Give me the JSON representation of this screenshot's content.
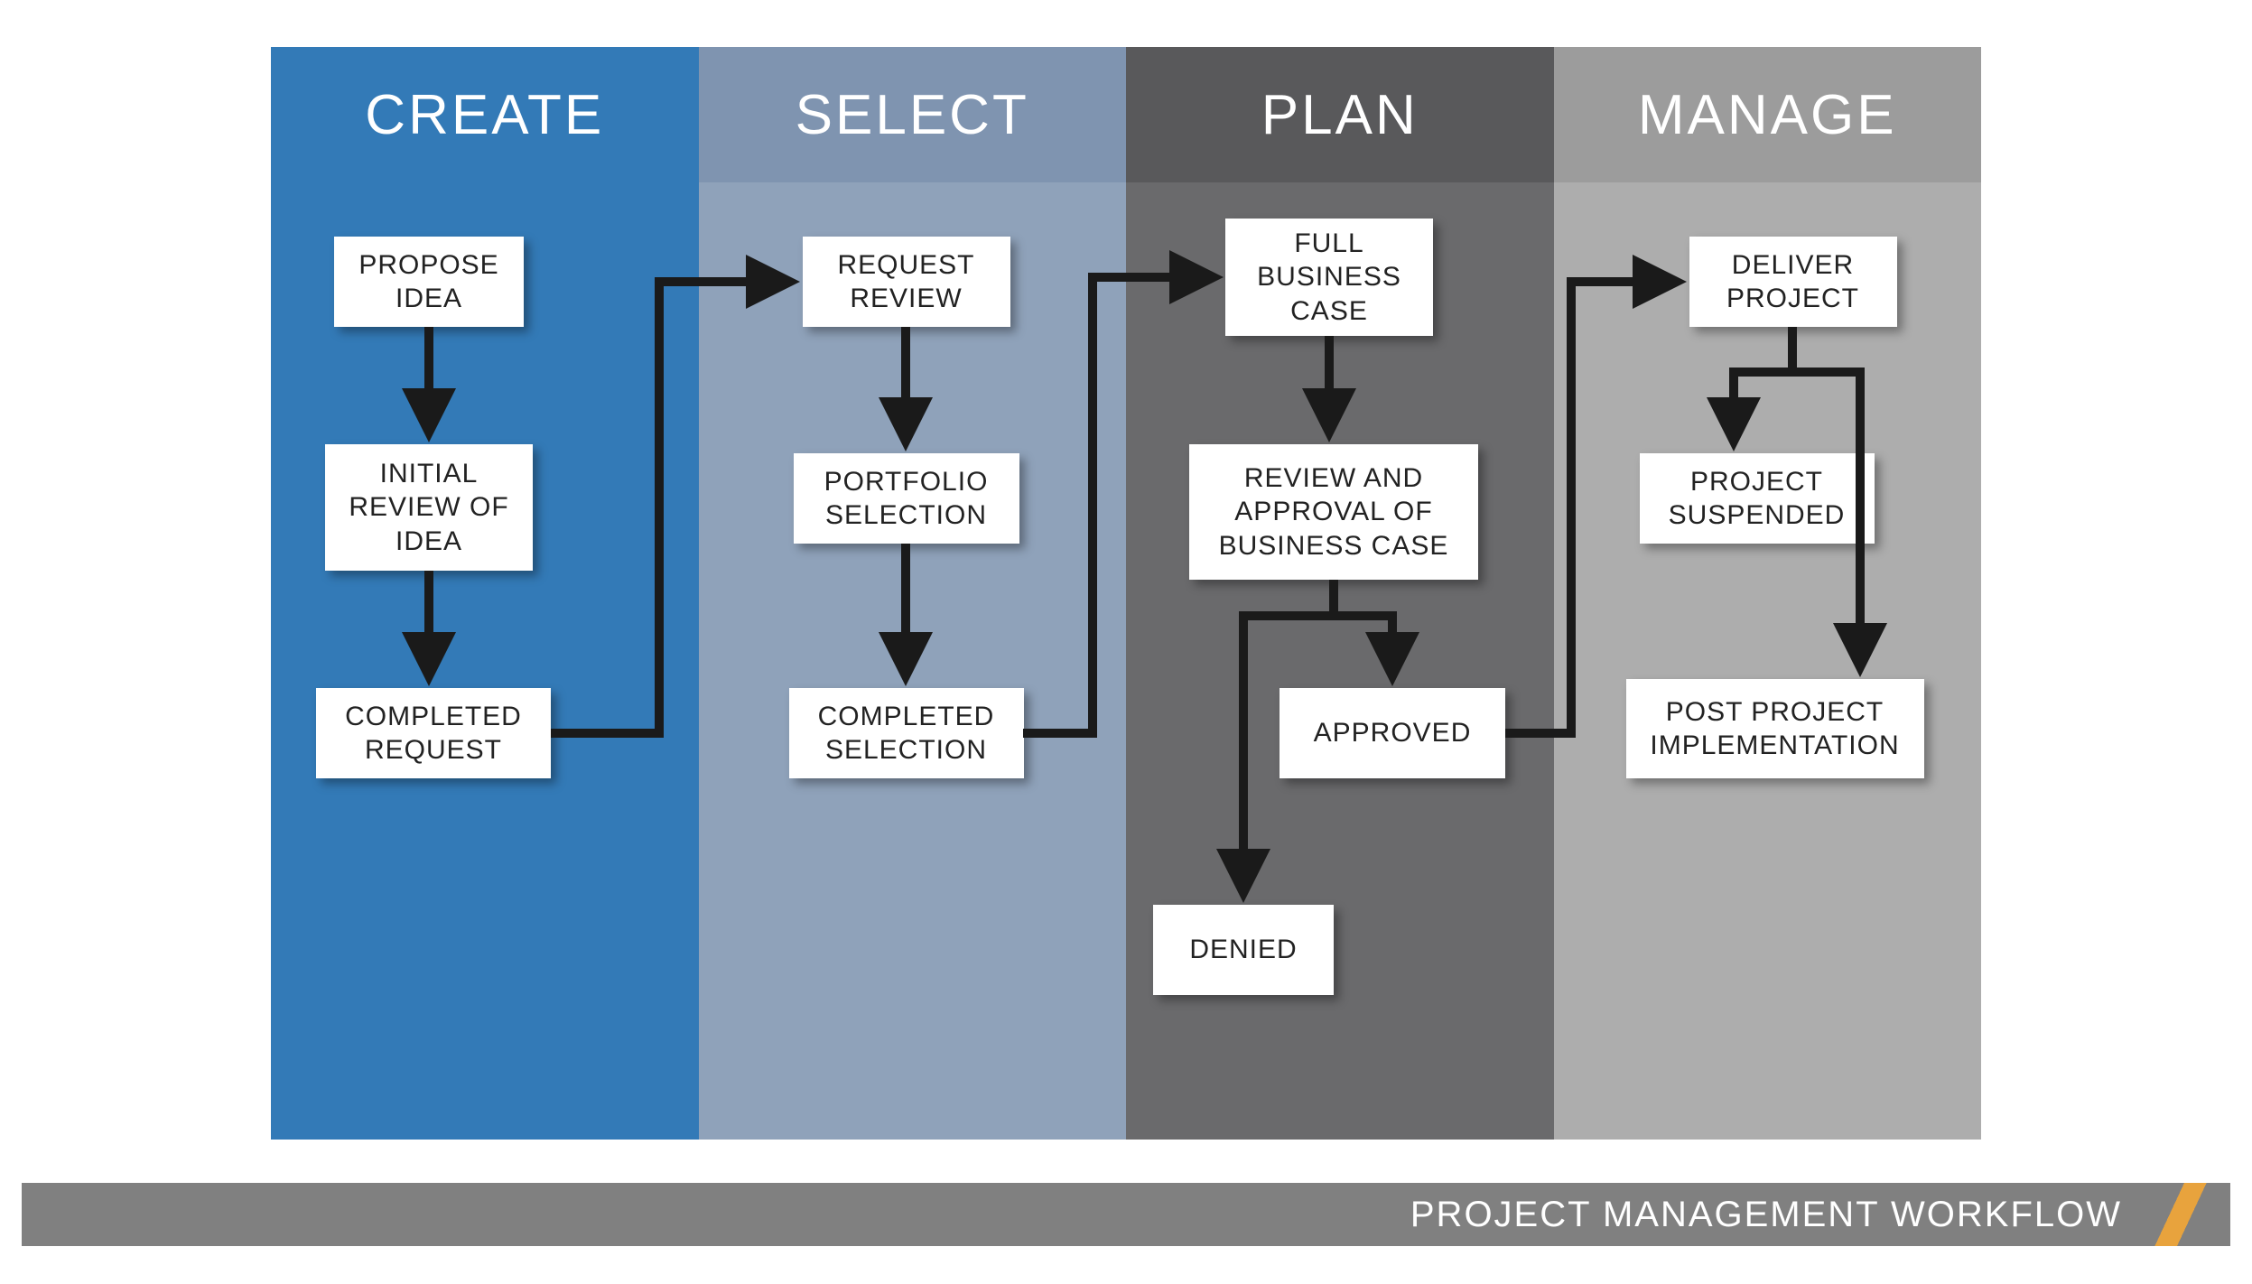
{
  "colors": {
    "lane1_head": "#337ab7",
    "lane1_body": "#337ab7",
    "lane2_head": "#7f94b0",
    "lane2_body": "#8fa2ba",
    "lane3_head": "#59595b",
    "lane3_body": "#6a6a6c",
    "lane4_head": "#9c9c9c",
    "lane4_body": "#adadad"
  },
  "lanes": {
    "l1": "CREATE",
    "l2": "SELECT",
    "l3": "PLAN",
    "l4": "MANAGE"
  },
  "boxes": {
    "propose_idea": "PROPOSE IDEA",
    "initial_review": "INITIAL REVIEW OF IDEA",
    "completed_request": "COMPLETED REQUEST",
    "request_review": "REQUEST REVIEW",
    "portfolio_selection": "PORTFOLIO SELECTION",
    "completed_selection": "COMPLETED SELECTION",
    "full_business_case": "FULL BUSINESS CASE",
    "review_approval": "REVIEW AND APPROVAL OF BUSINESS CASE",
    "approved": "APPROVED",
    "denied": "DENIED",
    "deliver_project": "DELIVER PROJECT",
    "project_suspended": "PROJECT SUSPENDED",
    "post_impl": "POST PROJECT IMPLEMENTATION"
  },
  "footer": {
    "title": "PROJECT MANAGEMENT WORKFLOW"
  }
}
